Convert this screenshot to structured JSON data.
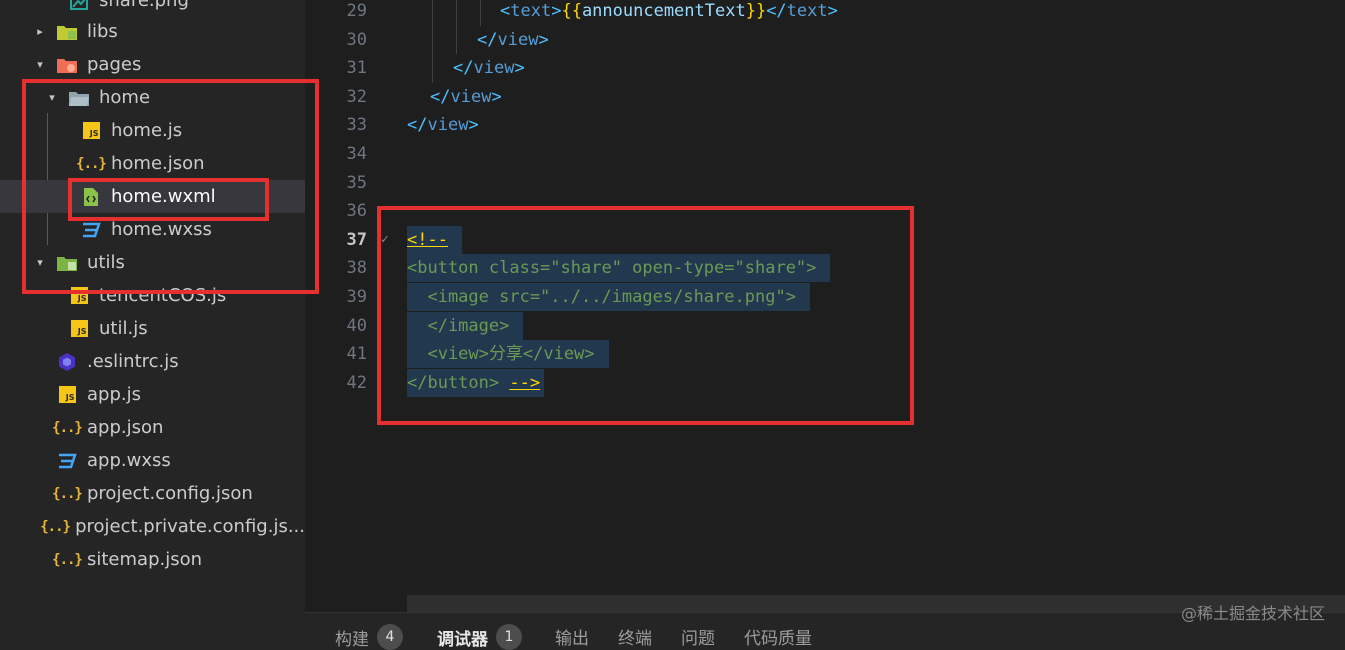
{
  "explorer": {
    "items": [
      {
        "label": "share.png",
        "type": "image",
        "depth": 2
      },
      {
        "label": "libs",
        "type": "folder-libs",
        "depth": 1,
        "arrow": "▸"
      },
      {
        "label": "pages",
        "type": "folder-pages",
        "depth": 1,
        "arrow": "▾"
      },
      {
        "label": "home",
        "type": "folder-open",
        "depth": 2,
        "arrow": "▾"
      },
      {
        "label": "home.js",
        "type": "js",
        "depth": 3
      },
      {
        "label": "home.json",
        "type": "json",
        "depth": 3
      },
      {
        "label": "home.wxml",
        "type": "wxml",
        "depth": 3,
        "selected": true
      },
      {
        "label": "home.wxss",
        "type": "wxss",
        "depth": 3
      },
      {
        "label": "utils",
        "type": "folder-utils",
        "depth": 1,
        "arrow": "▾"
      },
      {
        "label": "tencentCOS.js",
        "type": "js",
        "depth": 2
      },
      {
        "label": "util.js",
        "type": "js",
        "depth": 2
      },
      {
        "label": ".eslintrc.js",
        "type": "eslint",
        "depth": 1
      },
      {
        "label": "app.js",
        "type": "js",
        "depth": 1
      },
      {
        "label": "app.json",
        "type": "json",
        "depth": 1
      },
      {
        "label": "app.wxss",
        "type": "wxss",
        "depth": 1
      },
      {
        "label": "project.config.json",
        "type": "json",
        "depth": 1
      },
      {
        "label": "project.private.config.js...",
        "type": "json",
        "depth": 1
      },
      {
        "label": "sitemap.json",
        "type": "json",
        "depth": 1
      }
    ]
  },
  "editor": {
    "active_line": "37",
    "lines": [
      {
        "num": "29",
        "text": "            <text>{{announcementText}}</text>"
      },
      {
        "num": "30",
        "text": "          </view>"
      },
      {
        "num": "31",
        "text": "        </view>"
      },
      {
        "num": "32",
        "text": "      </view>"
      },
      {
        "num": "33",
        "text": "    </view>"
      },
      {
        "num": "34",
        "text": ""
      },
      {
        "num": "35",
        "text": ""
      },
      {
        "num": "36",
        "text": ""
      },
      {
        "num": "37",
        "text": "<!--"
      },
      {
        "num": "38",
        "text": "<button class=\"share\" open-type=\"share\">"
      },
      {
        "num": "39",
        "text": "  <image src=\"../../images/share.png\">"
      },
      {
        "num": "40",
        "text": "  </image>"
      },
      {
        "num": "41",
        "text": "  <view>分享</view>"
      },
      {
        "num": "42",
        "text": "</button> -->"
      }
    ],
    "check_mark": "✓"
  },
  "panel": {
    "tabs": [
      {
        "label": "构建",
        "badge": "4"
      },
      {
        "label": "调试器",
        "badge": "1",
        "active": true
      },
      {
        "label": "输出"
      },
      {
        "label": "终端"
      },
      {
        "label": "问题"
      },
      {
        "label": "代码质量"
      }
    ]
  },
  "watermark": "@稀土掘金技术社区",
  "colors": {
    "annotation_red": "#e5302f",
    "selection": "#37373d"
  }
}
